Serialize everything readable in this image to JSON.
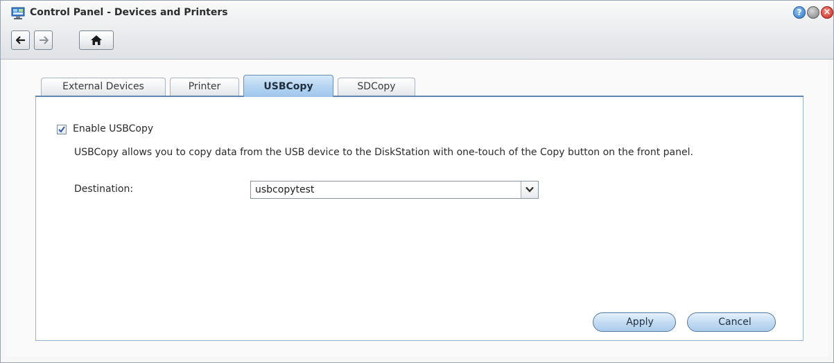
{
  "window": {
    "title": "Control Panel - Devices and Printers",
    "app_icon": "control-panel-icon",
    "controls": {
      "help": "?",
      "close": "×"
    }
  },
  "toolbar": {
    "back_icon": "arrow-left-icon",
    "forward_icon": "arrow-right-icon",
    "home_icon": "home-icon"
  },
  "tabs": [
    {
      "label": "External Devices",
      "active": false
    },
    {
      "label": "Printer",
      "active": false
    },
    {
      "label": "USBCopy",
      "active": true
    },
    {
      "label": "SDCopy",
      "active": false
    }
  ],
  "usbcopy": {
    "enable_label": "Enable USBCopy",
    "enabled": true,
    "description": "USBCopy allows you to copy data from the USB device to the DiskStation with one-touch of the Copy button on the front panel.",
    "destination_label": "Destination:",
    "destination_value": "usbcopytest"
  },
  "actions": {
    "apply": "Apply",
    "cancel": "Cancel"
  },
  "colors": {
    "active_tab": "#b3d3f1",
    "button_fill": "#c4dcf2",
    "panel_border": "#97b3cf"
  }
}
